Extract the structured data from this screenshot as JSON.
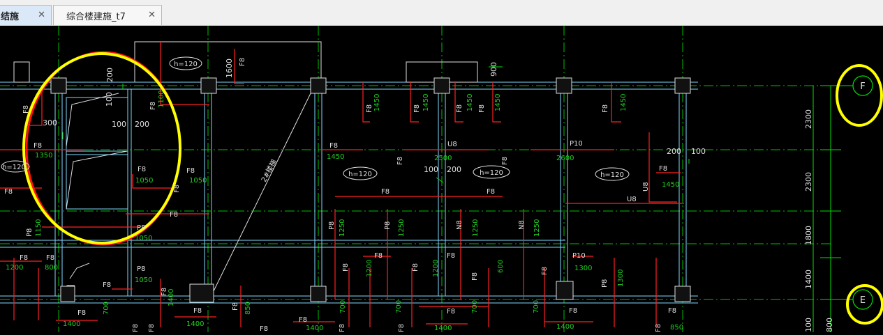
{
  "tabs": [
    {
      "label": "结施",
      "active": true
    },
    {
      "label": "综合楼建施_t7",
      "active": false
    }
  ],
  "close_glyph": "✕",
  "colors": {
    "background": "#000000",
    "axis": "#00ff00",
    "wall": "#7fd8ff",
    "rebar": "#ff2020",
    "highlight": "#ffff00"
  },
  "grid_markers": {
    "f": "F",
    "e": "E"
  },
  "dims": {
    "d2300a": "2300",
    "d2300b": "2300",
    "d1800": "1800",
    "d1400": "1400",
    "d100v": "100",
    "d800v": "800",
    "d1600": "1600",
    "d900": "900",
    "d200": "200",
    "d100a": "100",
    "d300": "300",
    "d100b": "100",
    "d200b": "200",
    "d100c": "100",
    "d200c": "200",
    "d200d": "200",
    "d100d": "100"
  },
  "slabs": {
    "h1": "h=120",
    "h2": "h=120",
    "h3": "h=120",
    "h4": "h=120",
    "h5": "h=120"
  },
  "rebar": {
    "f8": "F8",
    "p8": "P8",
    "u8": "U8",
    "n8": "N8",
    "p10": "P10",
    "v1450": "1450",
    "v1050": "1050",
    "v1350": "1350",
    "v1250": "1250",
    "v1200": "1200",
    "v1300": "1300",
    "v1400": "1400",
    "v800": "800",
    "v600": "600",
    "v700": "700",
    "v850": "850",
    "v2500": "2500",
    "v2600": "2600",
    "v1100": "1100",
    "v1150": "1150"
  },
  "stair_label": "2#楼梯"
}
